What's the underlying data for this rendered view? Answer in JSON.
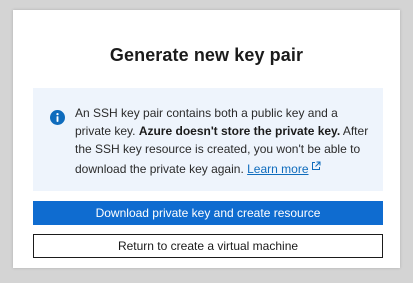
{
  "dialog": {
    "title": "Generate new key pair",
    "info": {
      "text_part1": "An SSH key pair contains both a public key and a private key. ",
      "text_bold": "Azure doesn't store the private key.",
      "text_part2": " After the SSH key resource is created, you won't be able to download the private key again. ",
      "link_label": "Learn more",
      "icon": "info-icon",
      "link_icon": "external-link-icon"
    },
    "primary_button": "Download private key and create resource",
    "secondary_button": "Return to create a virtual machine"
  },
  "colors": {
    "accent": "#0f6cd0",
    "link": "#0f6cbd",
    "info_background": "#eef4fc",
    "backdrop": "#d4d4d4"
  }
}
